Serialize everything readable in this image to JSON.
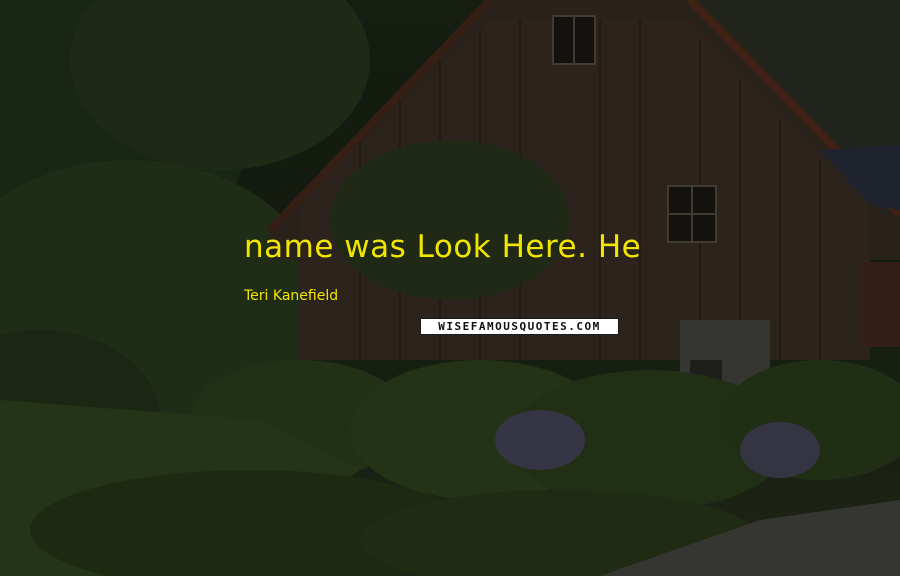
{
  "quote": {
    "text": "name was Look Here. He"
  },
  "author": {
    "name": "Teri Kanefield"
  },
  "watermark": {
    "text": "WISEFAMOUSQUOTES.COM"
  },
  "colors": {
    "quote_text": "#f2e600",
    "watermark_bg": "#ffffff"
  }
}
